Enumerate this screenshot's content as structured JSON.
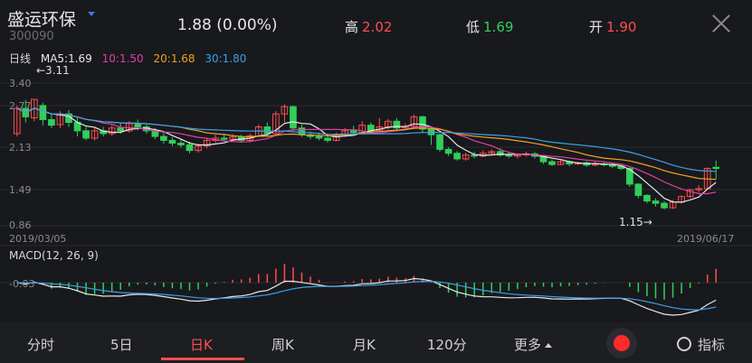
{
  "header": {
    "name": "盛运环保",
    "code": "300090",
    "price": "1.88",
    "change": "(0.00%)",
    "high_label": "高",
    "high_value": "2.02",
    "low_label": "低",
    "low_value": "1.69",
    "open_label": "开",
    "open_value": "1.90"
  },
  "ma_legend": {
    "period": "日线",
    "ma5": "MA5:1.69",
    "ma10": "10:1.50",
    "ma20": "20:1.68",
    "ma30": "30:1.80"
  },
  "price_chart": {
    "y_ticks": [
      "3.40",
      "2.77",
      "2.13",
      "1.49",
      "0.86"
    ],
    "max_note": "←3.11",
    "min_note": "1.15→",
    "start_date": "2019/03/05",
    "end_date": "2019/06/17"
  },
  "macd": {
    "label": "MACD(12, 26, 9)",
    "tick": "-0.03"
  },
  "tabs": [
    "分时",
    "5日",
    "日K",
    "周K",
    "月K",
    "120分",
    "更多",
    "指标"
  ],
  "colors": {
    "up": "#ff4d4d",
    "down": "#2fcf5a",
    "ma5": "#e8e8e8",
    "ma10": "#e040a0",
    "ma20": "#f0a020",
    "ma30": "#3aa0e8"
  },
  "chart_data": {
    "type": "candlestick",
    "ylim": [
      0.86,
      3.4
    ],
    "candles": [
      [
        2.5,
        2.95,
        3.0,
        2.45
      ],
      [
        2.95,
        2.8,
        3.1,
        2.7
      ],
      [
        2.78,
        3.11,
        3.11,
        2.72
      ],
      [
        3.0,
        2.75,
        3.05,
        2.65
      ],
      [
        2.75,
        2.65,
        2.85,
        2.6
      ],
      [
        2.66,
        2.85,
        2.9,
        2.6
      ],
      [
        2.85,
        2.7,
        2.92,
        2.62
      ],
      [
        2.7,
        2.55,
        2.78,
        2.45
      ],
      [
        2.55,
        2.42,
        2.62,
        2.38
      ],
      [
        2.42,
        2.55,
        2.6,
        2.38
      ],
      [
        2.55,
        2.5,
        2.62,
        2.45
      ],
      [
        2.5,
        2.6,
        2.65,
        2.46
      ],
      [
        2.6,
        2.55,
        2.68,
        2.5
      ],
      [
        2.55,
        2.68,
        2.72,
        2.52
      ],
      [
        2.68,
        2.62,
        2.75,
        2.56
      ],
      [
        2.62,
        2.55,
        2.66,
        2.5
      ],
      [
        2.55,
        2.45,
        2.6,
        2.4
      ],
      [
        2.45,
        2.38,
        2.52,
        2.32
      ],
      [
        2.38,
        2.33,
        2.44,
        2.28
      ],
      [
        2.33,
        2.3,
        2.4,
        2.25
      ],
      [
        2.3,
        2.2,
        2.36,
        2.15
      ],
      [
        2.2,
        2.28,
        2.32,
        2.16
      ],
      [
        2.28,
        2.38,
        2.42,
        2.24
      ],
      [
        2.38,
        2.42,
        2.48,
        2.34
      ],
      [
        2.42,
        2.4,
        2.5,
        2.36
      ],
      [
        2.4,
        2.44,
        2.49,
        2.37
      ],
      [
        2.44,
        2.38,
        2.48,
        2.34
      ],
      [
        2.38,
        2.46,
        2.5,
        2.35
      ],
      [
        2.46,
        2.62,
        2.66,
        2.44
      ],
      [
        2.62,
        2.5,
        2.7,
        2.46
      ],
      [
        2.5,
        2.85,
        2.9,
        2.48
      ],
      [
        2.85,
        2.98,
        3.02,
        2.7
      ],
      [
        2.98,
        2.6,
        3.0,
        2.55
      ],
      [
        2.6,
        2.48,
        2.66,
        2.44
      ],
      [
        2.48,
        2.45,
        2.54,
        2.4
      ],
      [
        2.45,
        2.42,
        2.52,
        2.38
      ],
      [
        2.42,
        2.38,
        2.48,
        2.34
      ],
      [
        2.38,
        2.48,
        2.52,
        2.36
      ],
      [
        2.48,
        2.55,
        2.6,
        2.44
      ],
      [
        2.55,
        2.52,
        2.64,
        2.48
      ],
      [
        2.52,
        2.65,
        2.72,
        2.5
      ],
      [
        2.65,
        2.55,
        2.7,
        2.5
      ],
      [
        2.55,
        2.62,
        2.78,
        2.52
      ],
      [
        2.62,
        2.72,
        2.76,
        2.58
      ],
      [
        2.72,
        2.6,
        2.78,
        2.56
      ],
      [
        2.6,
        2.63,
        2.68,
        2.56
      ],
      [
        2.63,
        2.8,
        2.84,
        2.6
      ],
      [
        2.8,
        2.58,
        2.82,
        2.52
      ],
      [
        2.58,
        2.48,
        2.62,
        2.3
      ],
      [
        2.48,
        2.22,
        2.5,
        2.18
      ],
      [
        2.22,
        2.15,
        2.26,
        2.1
      ],
      [
        2.15,
        2.05,
        2.19,
        2.02
      ],
      [
        2.05,
        2.12,
        2.16,
        2.02
      ],
      [
        2.12,
        2.1,
        2.18,
        2.06
      ],
      [
        2.1,
        2.15,
        2.2,
        2.08
      ],
      [
        2.15,
        2.18,
        2.22,
        2.12
      ],
      [
        2.18,
        2.12,
        2.24,
        2.09
      ],
      [
        2.12,
        2.1,
        2.16,
        2.07
      ],
      [
        2.1,
        2.12,
        2.15,
        2.06
      ],
      [
        2.12,
        2.14,
        2.18,
        2.09
      ],
      [
        2.14,
        2.1,
        2.17,
        2.06
      ],
      [
        2.1,
        2.0,
        2.12,
        1.96
      ],
      [
        2.0,
        1.95,
        2.04,
        1.92
      ],
      [
        1.95,
        2.0,
        2.04,
        1.94
      ],
      [
        2.0,
        1.96,
        2.02,
        1.92
      ],
      [
        1.96,
        1.98,
        2.0,
        1.94
      ],
      [
        1.98,
        1.94,
        2.01,
        1.91
      ],
      [
        1.94,
        1.96,
        2.0,
        1.92
      ],
      [
        1.96,
        1.95,
        1.99,
        1.92
      ],
      [
        1.95,
        1.92,
        1.97,
        1.89
      ],
      [
        1.92,
        1.88,
        1.94,
        1.85
      ],
      [
        1.88,
        1.6,
        1.9,
        1.55
      ],
      [
        1.6,
        1.4,
        1.62,
        1.35
      ],
      [
        1.4,
        1.3,
        1.42,
        1.26
      ],
      [
        1.3,
        1.26,
        1.35,
        1.2
      ],
      [
        1.26,
        1.18,
        1.3,
        1.15
      ],
      [
        1.18,
        1.28,
        1.32,
        1.16
      ],
      [
        1.28,
        1.38,
        1.4,
        1.25
      ],
      [
        1.38,
        1.5,
        1.52,
        1.35
      ],
      [
        1.5,
        1.52,
        1.58,
        1.45
      ],
      [
        1.52,
        1.88,
        1.9,
        1.5
      ],
      [
        1.9,
        1.88,
        2.02,
        1.69
      ]
    ]
  }
}
